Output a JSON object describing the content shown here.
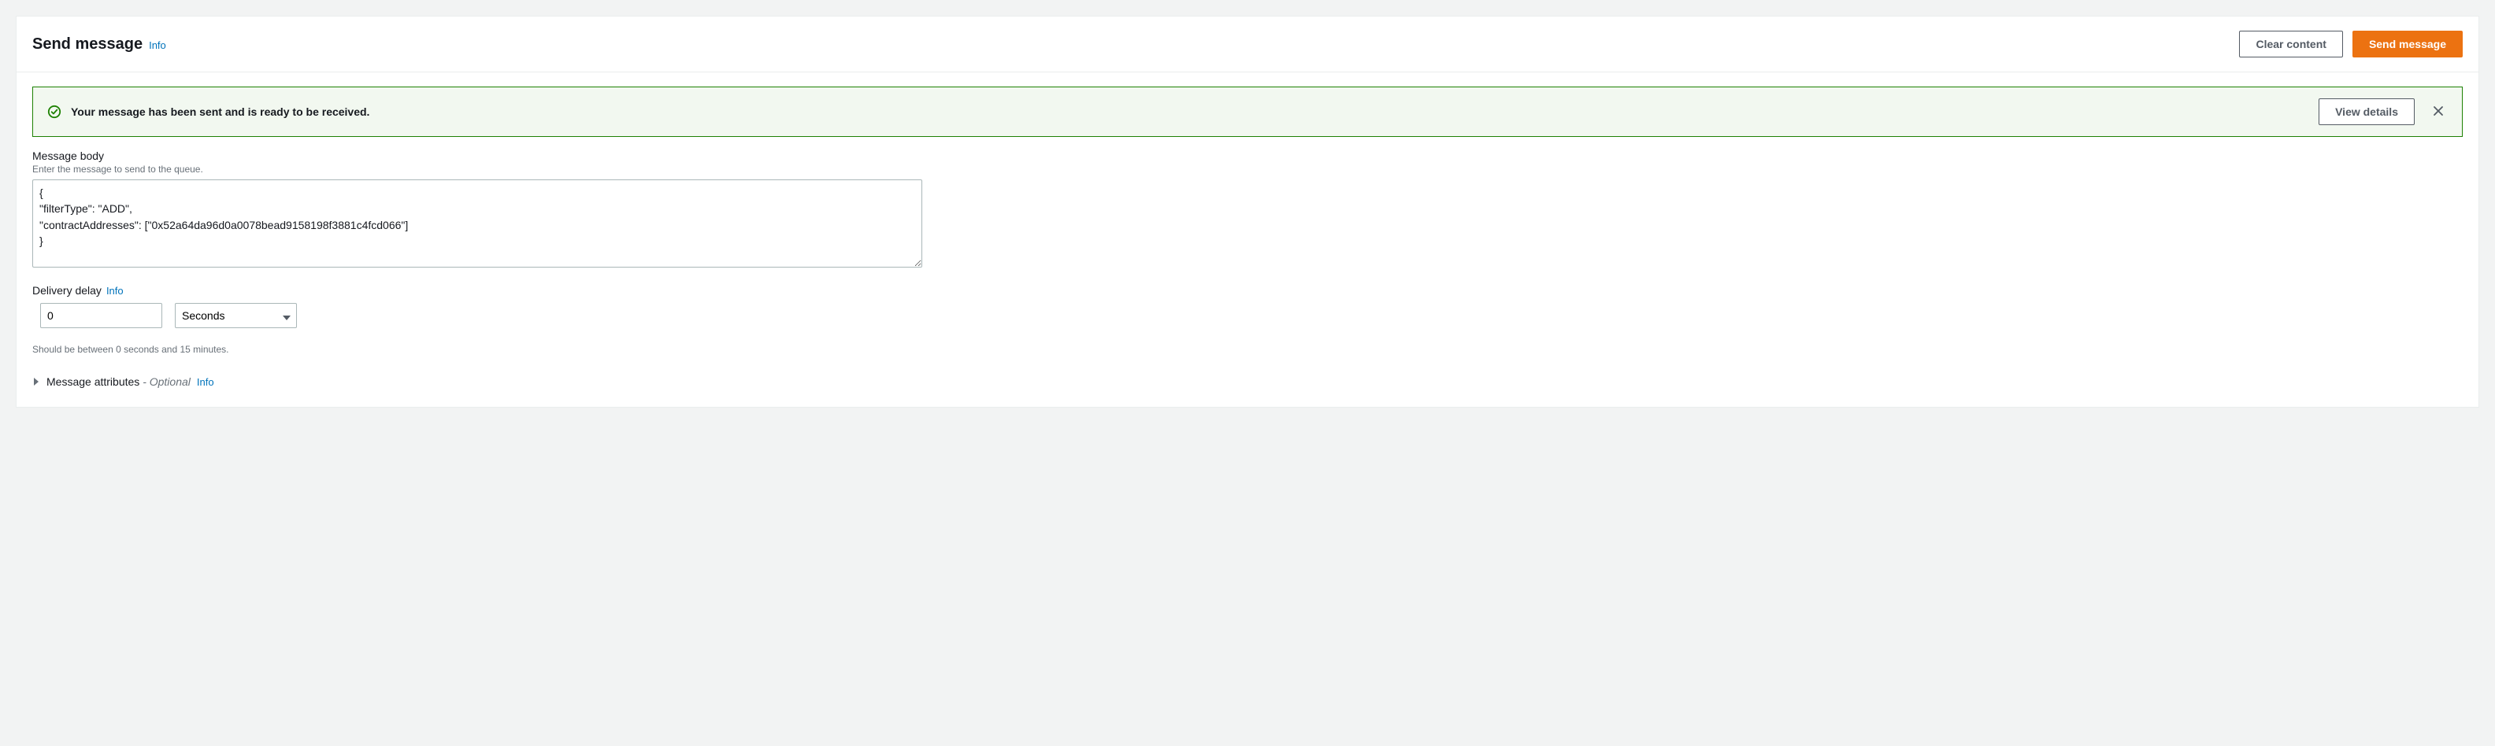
{
  "header": {
    "title": "Send message",
    "info": "Info",
    "clear_button": "Clear content",
    "send_button": "Send message"
  },
  "alert": {
    "message": "Your message has been sent and is ready to be received.",
    "view_details": "View details"
  },
  "body": {
    "label": "Message body",
    "hint": "Enter the message to send to the queue.",
    "value": "{\n\"filterType\": \"ADD\",\n\"contractAddresses\": [\"0x52a64da96d0a0078bead9158198f3881c4fcd066\"]\n}"
  },
  "delay": {
    "label": "Delivery delay",
    "info": "Info",
    "value": "0",
    "unit": "Seconds",
    "constraint": "Should be between 0 seconds and 15 minutes."
  },
  "attributes": {
    "label": "Message attributes",
    "optional": "- Optional",
    "info": "Info"
  }
}
